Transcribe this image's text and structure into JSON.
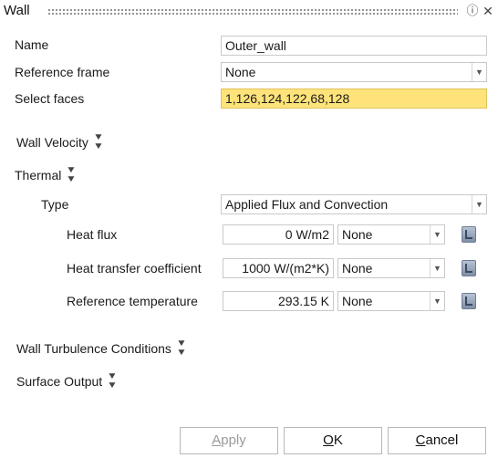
{
  "title": "Wall",
  "name_label": "Name",
  "name_value": "Outer_wall",
  "reference_frame_label": "Reference frame",
  "reference_frame_value": "None",
  "select_faces_label": "Select faces",
  "select_faces_value": "1,126,124,122,68,128",
  "wall_velocity_label": "Wall Velocity",
  "thermal_label": "Thermal",
  "type_label": "Type",
  "type_value": "Applied Flux and Convection",
  "heat_flux": {
    "label": "Heat flux",
    "value": "0 W/m2",
    "ref": "None"
  },
  "heat_transfer": {
    "label": "Heat transfer coefficient",
    "value": "1000 W/(m2*K)",
    "ref": "None"
  },
  "reference_temperature": {
    "label": "Reference temperature",
    "value": "293.15 K",
    "ref": "None"
  },
  "wall_turbulence_label": "Wall Turbulence Conditions",
  "surface_output_label": "Surface Output",
  "buttons": {
    "apply_first": "A",
    "apply_rest": "pply",
    "ok_first": "O",
    "ok_rest": "K",
    "cancel_first": "C",
    "cancel_rest": "ancel"
  },
  "icons": {
    "help": "help-icon",
    "close": "close-icon",
    "expand": "chevron-double-down-icon",
    "dropdown": "chevron-down-icon",
    "pick": "table-picker-icon"
  }
}
